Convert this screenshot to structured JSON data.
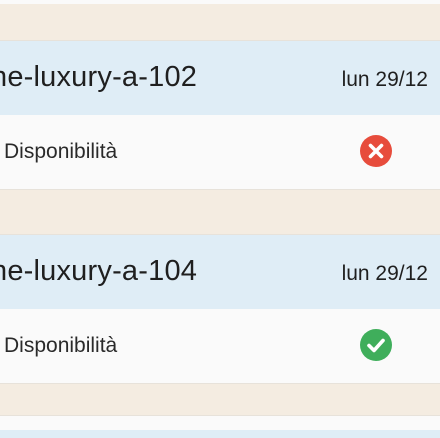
{
  "bookings": [
    {
      "room": "ne-luxury-a-102",
      "date": "lun 29/12",
      "availability_label": "Disponibilità",
      "status": "unavailable",
      "status_color": "#e74c3c",
      "status_icon": "x-circle-icon"
    },
    {
      "room": "ne-luxury-a-104",
      "date": "lun 29/12",
      "availability_label": "Disponibilità",
      "status": "available",
      "status_color": "#3fae5b",
      "status_icon": "check-circle-icon"
    }
  ]
}
